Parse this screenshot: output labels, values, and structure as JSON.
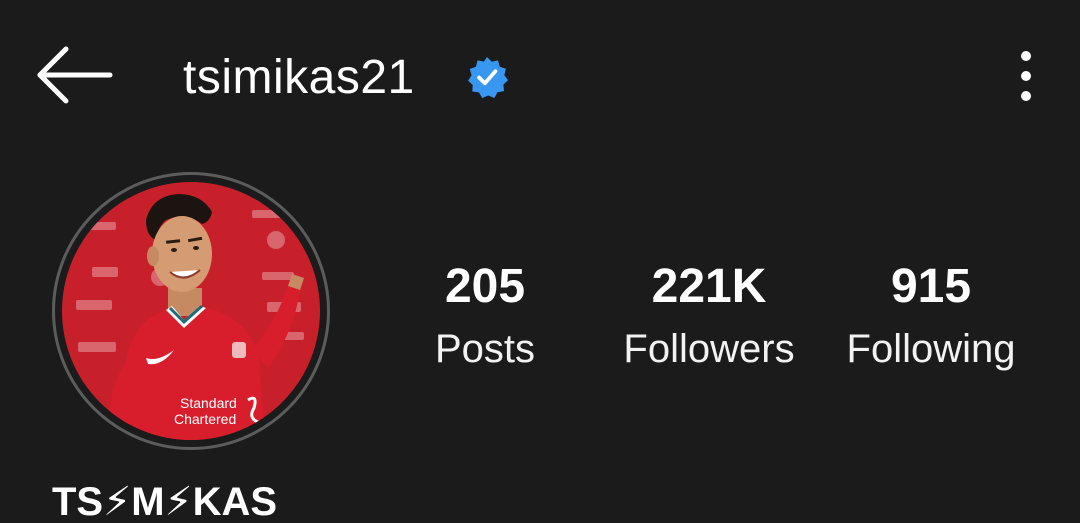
{
  "header": {
    "back_icon": "arrow-left-icon",
    "username": "tsimikas21",
    "verified_icon": "verified-badge-icon",
    "menu_icon": "more-vertical-icon"
  },
  "profile": {
    "avatar_icon": "profile-picture",
    "display_name": "TS⚡M⚡KAS"
  },
  "stats": {
    "posts": {
      "value": "205",
      "label": "Posts"
    },
    "followers": {
      "value": "221K",
      "label": "Followers"
    },
    "following": {
      "value": "915",
      "label": "Following"
    }
  },
  "avatar_text": {
    "sponsor_line1": "Standard",
    "sponsor_line2": "Chartered"
  },
  "colors": {
    "background": "#1b1b1b",
    "verified_blue": "#3897f0",
    "jersey_red": "#d21f2b",
    "text": "#ffffff"
  }
}
